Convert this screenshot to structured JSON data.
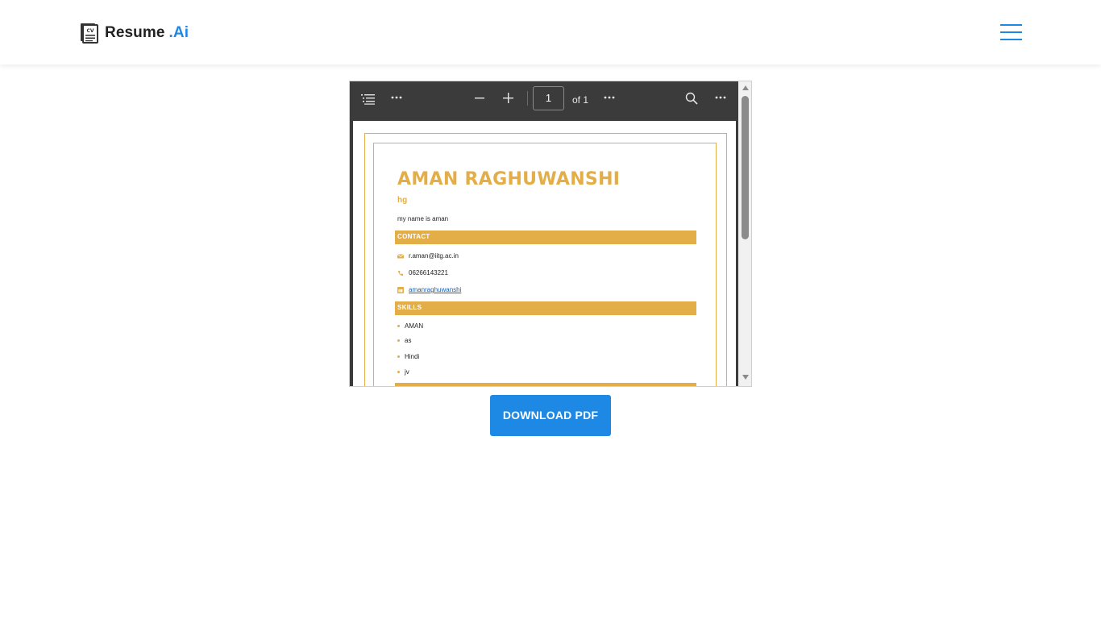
{
  "header": {
    "brand_name": "Resume",
    "brand_suffix": ".Ai",
    "brand_icon_label": "CV",
    "brand_color": "#1e88e5",
    "menu_icon": "hamburger-icon"
  },
  "pdf_viewer": {
    "toolbar": {
      "outline_icon": "outline-icon",
      "more_icon": "more-horizontal-icon",
      "zoom_out_icon": "minus-icon",
      "zoom_in_icon": "plus-icon",
      "page_number": "1",
      "page_total": "of 1",
      "search_icon": "search-icon"
    },
    "resume": {
      "name": "AMAN RAGHUWANSHI",
      "subtitle": "hg",
      "about": "my name is aman",
      "contact_heading": "CONTACT",
      "email": "r.aman@iitg.ac.in",
      "phone": "06266143221",
      "linkedin": "amanraghuwanshi",
      "skills_heading": "SKILLS",
      "skills": [
        "AMAN",
        "as",
        "Hindi",
        "jv"
      ],
      "accent_color": "#e3ad47"
    }
  },
  "actions": {
    "download_label": "DOWNLOAD PDF"
  }
}
